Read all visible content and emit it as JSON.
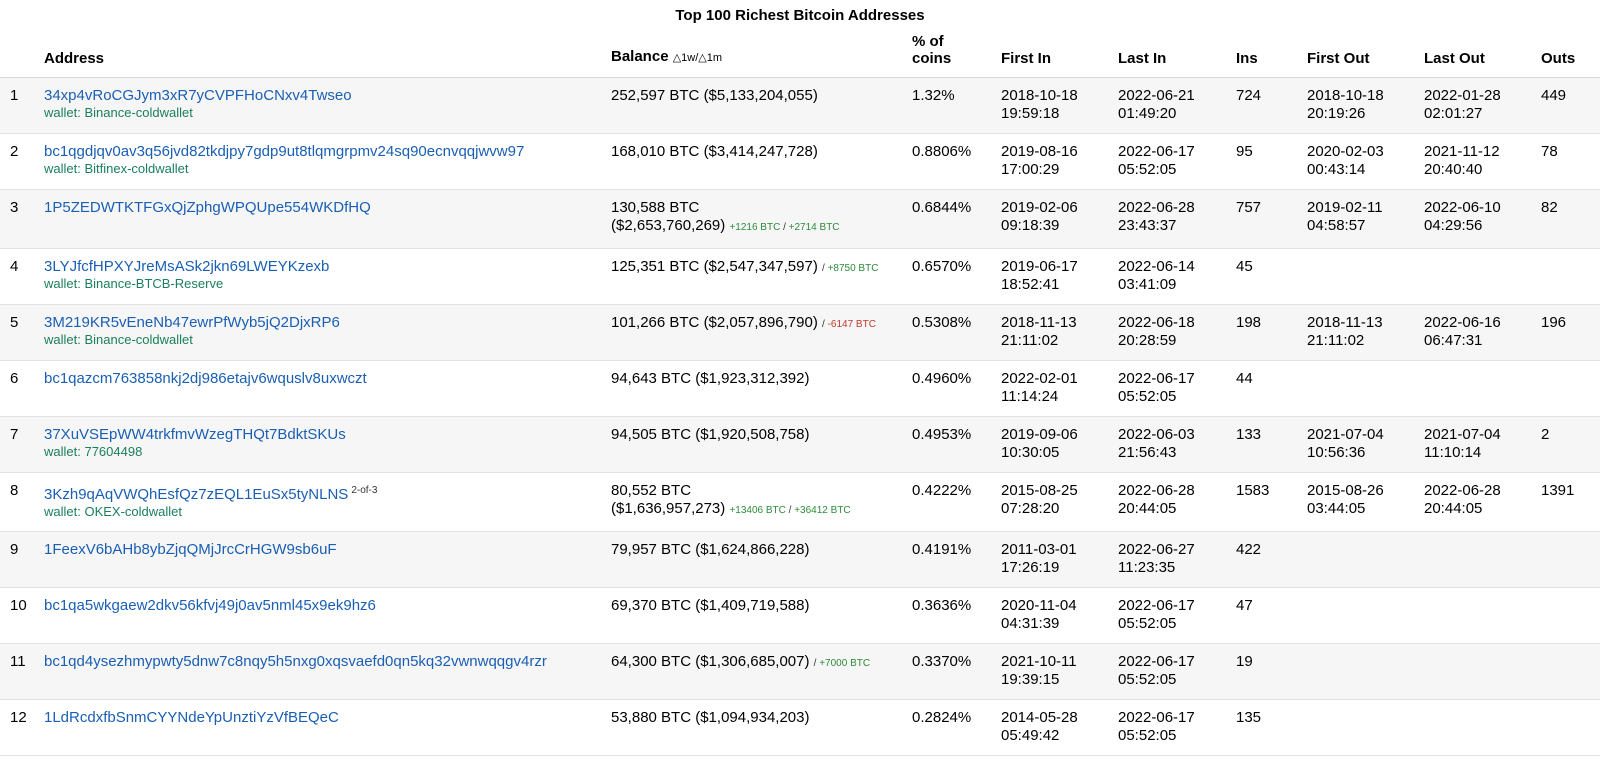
{
  "title": "Top 100 Richest Bitcoin Addresses",
  "colors": {
    "link": "#1a5fb4",
    "wallet": "#1a7f5a",
    "positive": "#2e8b3a",
    "negative": "#c0392b"
  },
  "headers": {
    "address": "Address",
    "balance": "Balance",
    "balance_delta": "△1w/△1m",
    "pct_line1": "% of",
    "pct_line2": "coins",
    "first_in": "First In",
    "last_in": "Last In",
    "ins": "Ins",
    "first_out": "First Out",
    "last_out": "Last Out",
    "outs": "Outs"
  },
  "rows": [
    {
      "rank": "1",
      "address": "34xp4vRoCGJym3xR7yCVPFHoCNxv4Twseo",
      "tag": "",
      "wallet": "wallet: Binance-coldwallet",
      "btc": "252,597 BTC",
      "usd": "($5,133,204,055)",
      "d1w": "",
      "d1m": "",
      "pct": "1.32%",
      "first_in_d": "2018-10-18",
      "first_in_t": "19:59:18",
      "last_in_d": "2022-06-21",
      "last_in_t": "01:49:20",
      "ins": "724",
      "first_out_d": "2018-10-18",
      "first_out_t": "20:19:26",
      "last_out_d": "2022-01-28",
      "last_out_t": "02:01:27",
      "outs": "449"
    },
    {
      "rank": "2",
      "address": "bc1qgdjqv0av3q56jvd82tkdjpy7gdp9ut8tlqmgrpmv24sq90ecnvqqjwvw97",
      "tag": "",
      "wallet": "wallet: Bitfinex-coldwallet",
      "btc": "168,010 BTC",
      "usd": "($3,414,247,728)",
      "d1w": "",
      "d1m": "",
      "pct": "0.8806%",
      "first_in_d": "2019-08-16",
      "first_in_t": "17:00:29",
      "last_in_d": "2022-06-17",
      "last_in_t": "05:52:05",
      "ins": "95",
      "first_out_d": "2020-02-03",
      "first_out_t": "00:43:14",
      "last_out_d": "2021-11-12",
      "last_out_t": "20:40:40",
      "outs": "78"
    },
    {
      "rank": "3",
      "address": "1P5ZEDWTKTFGxQjZphgWPQUpe554WKDfHQ",
      "tag": "",
      "wallet": "",
      "btc": "130,588 BTC",
      "usd": "($2,653,760,269)",
      "d1w": "+1216 BTC",
      "d1m": "+2714 BTC",
      "pct": "0.6844%",
      "first_in_d": "2019-02-06",
      "first_in_t": "09:18:39",
      "last_in_d": "2022-06-28",
      "last_in_t": "23:43:37",
      "ins": "757",
      "first_out_d": "2019-02-11",
      "first_out_t": "04:58:57",
      "last_out_d": "2022-06-10",
      "last_out_t": "04:29:56",
      "outs": "82"
    },
    {
      "rank": "4",
      "address": "3LYJfcfHPXYJreMsASk2jkn69LWEYKzexb",
      "tag": "",
      "wallet": "wallet: Binance-BTCB-Reserve",
      "btc": "125,351 BTC",
      "usd": "($2,547,347,597)",
      "d1w": "",
      "d1m": "+8750 BTC",
      "pct": "0.6570%",
      "first_in_d": "2019-06-17",
      "first_in_t": "18:52:41",
      "last_in_d": "2022-06-14",
      "last_in_t": "03:41:09",
      "ins": "45",
      "first_out_d": "",
      "first_out_t": "",
      "last_out_d": "",
      "last_out_t": "",
      "outs": ""
    },
    {
      "rank": "5",
      "address": "3M219KR5vEneNb47ewrPfWyb5jQ2DjxRP6",
      "tag": "",
      "wallet": "wallet: Binance-coldwallet",
      "btc": "101,266 BTC",
      "usd": "($2,057,896,790)",
      "d1w": "",
      "d1m": "-6147 BTC",
      "pct": "0.5308%",
      "first_in_d": "2018-11-13",
      "first_in_t": "21:11:02",
      "last_in_d": "2022-06-18",
      "last_in_t": "20:28:59",
      "ins": "198",
      "first_out_d": "2018-11-13",
      "first_out_t": "21:11:02",
      "last_out_d": "2022-06-16",
      "last_out_t": "06:47:31",
      "outs": "196"
    },
    {
      "rank": "6",
      "address": "bc1qazcm763858nkj2dj986etajv6wquslv8uxwczt",
      "tag": "",
      "wallet": "",
      "btc": "94,643 BTC",
      "usd": "($1,923,312,392)",
      "d1w": "",
      "d1m": "",
      "pct": "0.4960%",
      "first_in_d": "2022-02-01",
      "first_in_t": "11:14:24",
      "last_in_d": "2022-06-17",
      "last_in_t": "05:52:05",
      "ins": "44",
      "first_out_d": "",
      "first_out_t": "",
      "last_out_d": "",
      "last_out_t": "",
      "outs": ""
    },
    {
      "rank": "7",
      "address": "37XuVSEpWW4trkfmvWzegTHQt7BdktSKUs",
      "tag": "",
      "wallet": "wallet: 77604498",
      "btc": "94,505 BTC",
      "usd": "($1,920,508,758)",
      "d1w": "",
      "d1m": "",
      "pct": "0.4953%",
      "first_in_d": "2019-09-06",
      "first_in_t": "10:30:05",
      "last_in_d": "2022-06-03",
      "last_in_t": "21:56:43",
      "ins": "133",
      "first_out_d": "2021-07-04",
      "first_out_t": "10:56:36",
      "last_out_d": "2021-07-04",
      "last_out_t": "11:10:14",
      "outs": "2"
    },
    {
      "rank": "8",
      "address": "3Kzh9qAqVWQhEsfQz7zEQL1EuSx5tyNLNS",
      "tag": "2-of-3",
      "wallet": "wallet: OKEX-coldwallet",
      "btc": "80,552 BTC",
      "usd": "($1,636,957,273)",
      "d1w": "+13406 BTC",
      "d1m": "+36412 BTC",
      "pct": "0.4222%",
      "first_in_d": "2015-08-25",
      "first_in_t": "07:28:20",
      "last_in_d": "2022-06-28",
      "last_in_t": "20:44:05",
      "ins": "1583",
      "first_out_d": "2015-08-26",
      "first_out_t": "03:44:05",
      "last_out_d": "2022-06-28",
      "last_out_t": "20:44:05",
      "outs": "1391"
    },
    {
      "rank": "9",
      "address": "1FeexV6bAHb8ybZjqQMjJrcCrHGW9sb6uF",
      "tag": "",
      "wallet": "",
      "btc": "79,957 BTC",
      "usd": "($1,624,866,228)",
      "d1w": "",
      "d1m": "",
      "pct": "0.4191%",
      "first_in_d": "2011-03-01",
      "first_in_t": "17:26:19",
      "last_in_d": "2022-06-27",
      "last_in_t": "11:23:35",
      "ins": "422",
      "first_out_d": "",
      "first_out_t": "",
      "last_out_d": "",
      "last_out_t": "",
      "outs": ""
    },
    {
      "rank": "10",
      "address": "bc1qa5wkgaew2dkv56kfvj49j0av5nml45x9ek9hz6",
      "tag": "",
      "wallet": "",
      "btc": "69,370 BTC",
      "usd": "($1,409,719,588)",
      "d1w": "",
      "d1m": "",
      "pct": "0.3636%",
      "first_in_d": "2020-11-04",
      "first_in_t": "04:31:39",
      "last_in_d": "2022-06-17",
      "last_in_t": "05:52:05",
      "ins": "47",
      "first_out_d": "",
      "first_out_t": "",
      "last_out_d": "",
      "last_out_t": "",
      "outs": ""
    },
    {
      "rank": "11",
      "address": "bc1qd4ysezhmypwty5dnw7c8nqy5h5nxg0xqsvaefd0qn5kq32vwnwqqgv4rzr",
      "tag": "",
      "wallet": "",
      "btc": "64,300 BTC",
      "usd": "($1,306,685,007)",
      "d1w": "",
      "d1m": "+7000 BTC",
      "pct": "0.3370%",
      "first_in_d": "2021-10-11",
      "first_in_t": "19:39:15",
      "last_in_d": "2022-06-17",
      "last_in_t": "05:52:05",
      "ins": "19",
      "first_out_d": "",
      "first_out_t": "",
      "last_out_d": "",
      "last_out_t": "",
      "outs": ""
    },
    {
      "rank": "12",
      "address": "1LdRcdxfbSnmCYYNdeYpUnztiYzVfBEQeC",
      "tag": "",
      "wallet": "",
      "btc": "53,880 BTC",
      "usd": "($1,094,934,203)",
      "d1w": "",
      "d1m": "",
      "pct": "0.2824%",
      "first_in_d": "2014-05-28",
      "first_in_t": "05:49:42",
      "last_in_d": "2022-06-17",
      "last_in_t": "05:52:05",
      "ins": "135",
      "first_out_d": "",
      "first_out_t": "",
      "last_out_d": "",
      "last_out_t": "",
      "outs": ""
    }
  ]
}
